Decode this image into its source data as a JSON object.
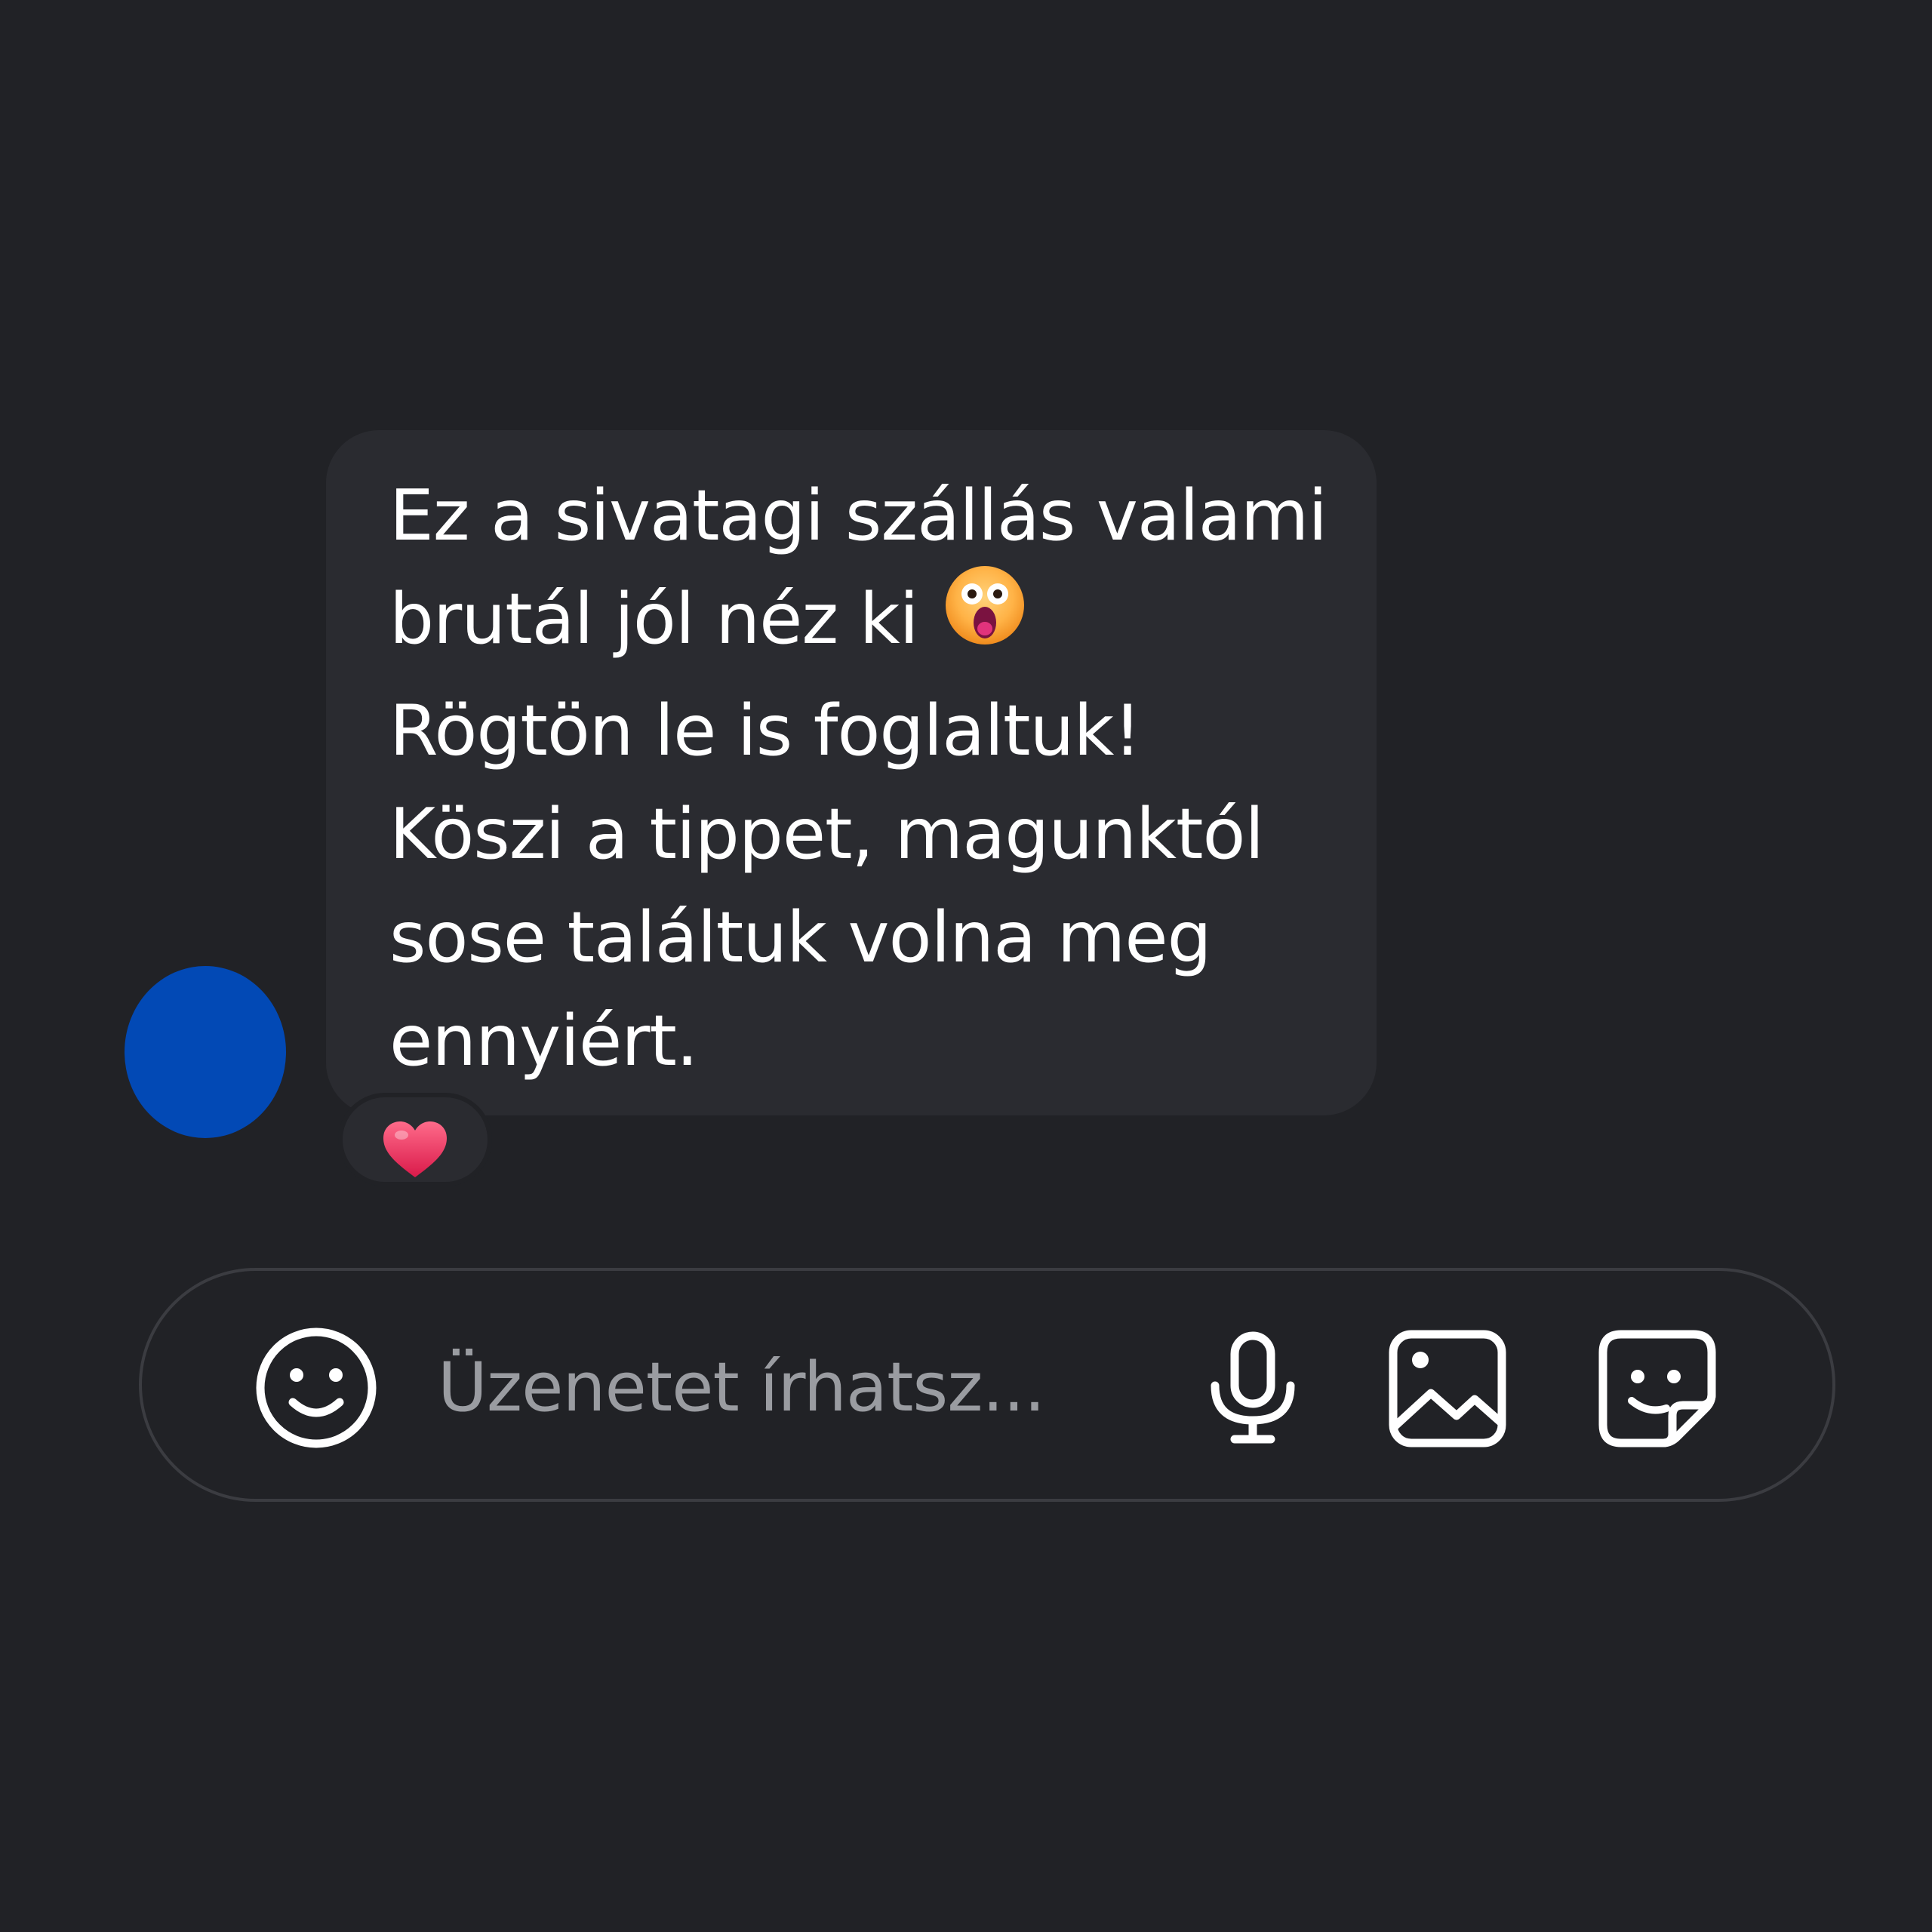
{
  "message": {
    "lines": [
      "Ez a sivatagi szállás valami",
      "brutál jól néz ki",
      "Rögtön le is foglaltuk!",
      "Köszi a tippet, magunktól",
      "sose találtuk volna meg",
      "ennyiért."
    ],
    "inline_emoji": "shocked-face-emoji"
  },
  "reaction": {
    "emoji": "heart-emoji"
  },
  "composer": {
    "placeholder": "Üzenetet írhatsz...",
    "icons": [
      "smiley-icon",
      "microphone-icon",
      "image-icon",
      "sticker-icon"
    ]
  },
  "colors": {
    "background": "#212226",
    "bubble": "#2a2b30",
    "avatar": "#0249b5",
    "text": "#ffffff",
    "placeholder": "#9a9ca1"
  }
}
